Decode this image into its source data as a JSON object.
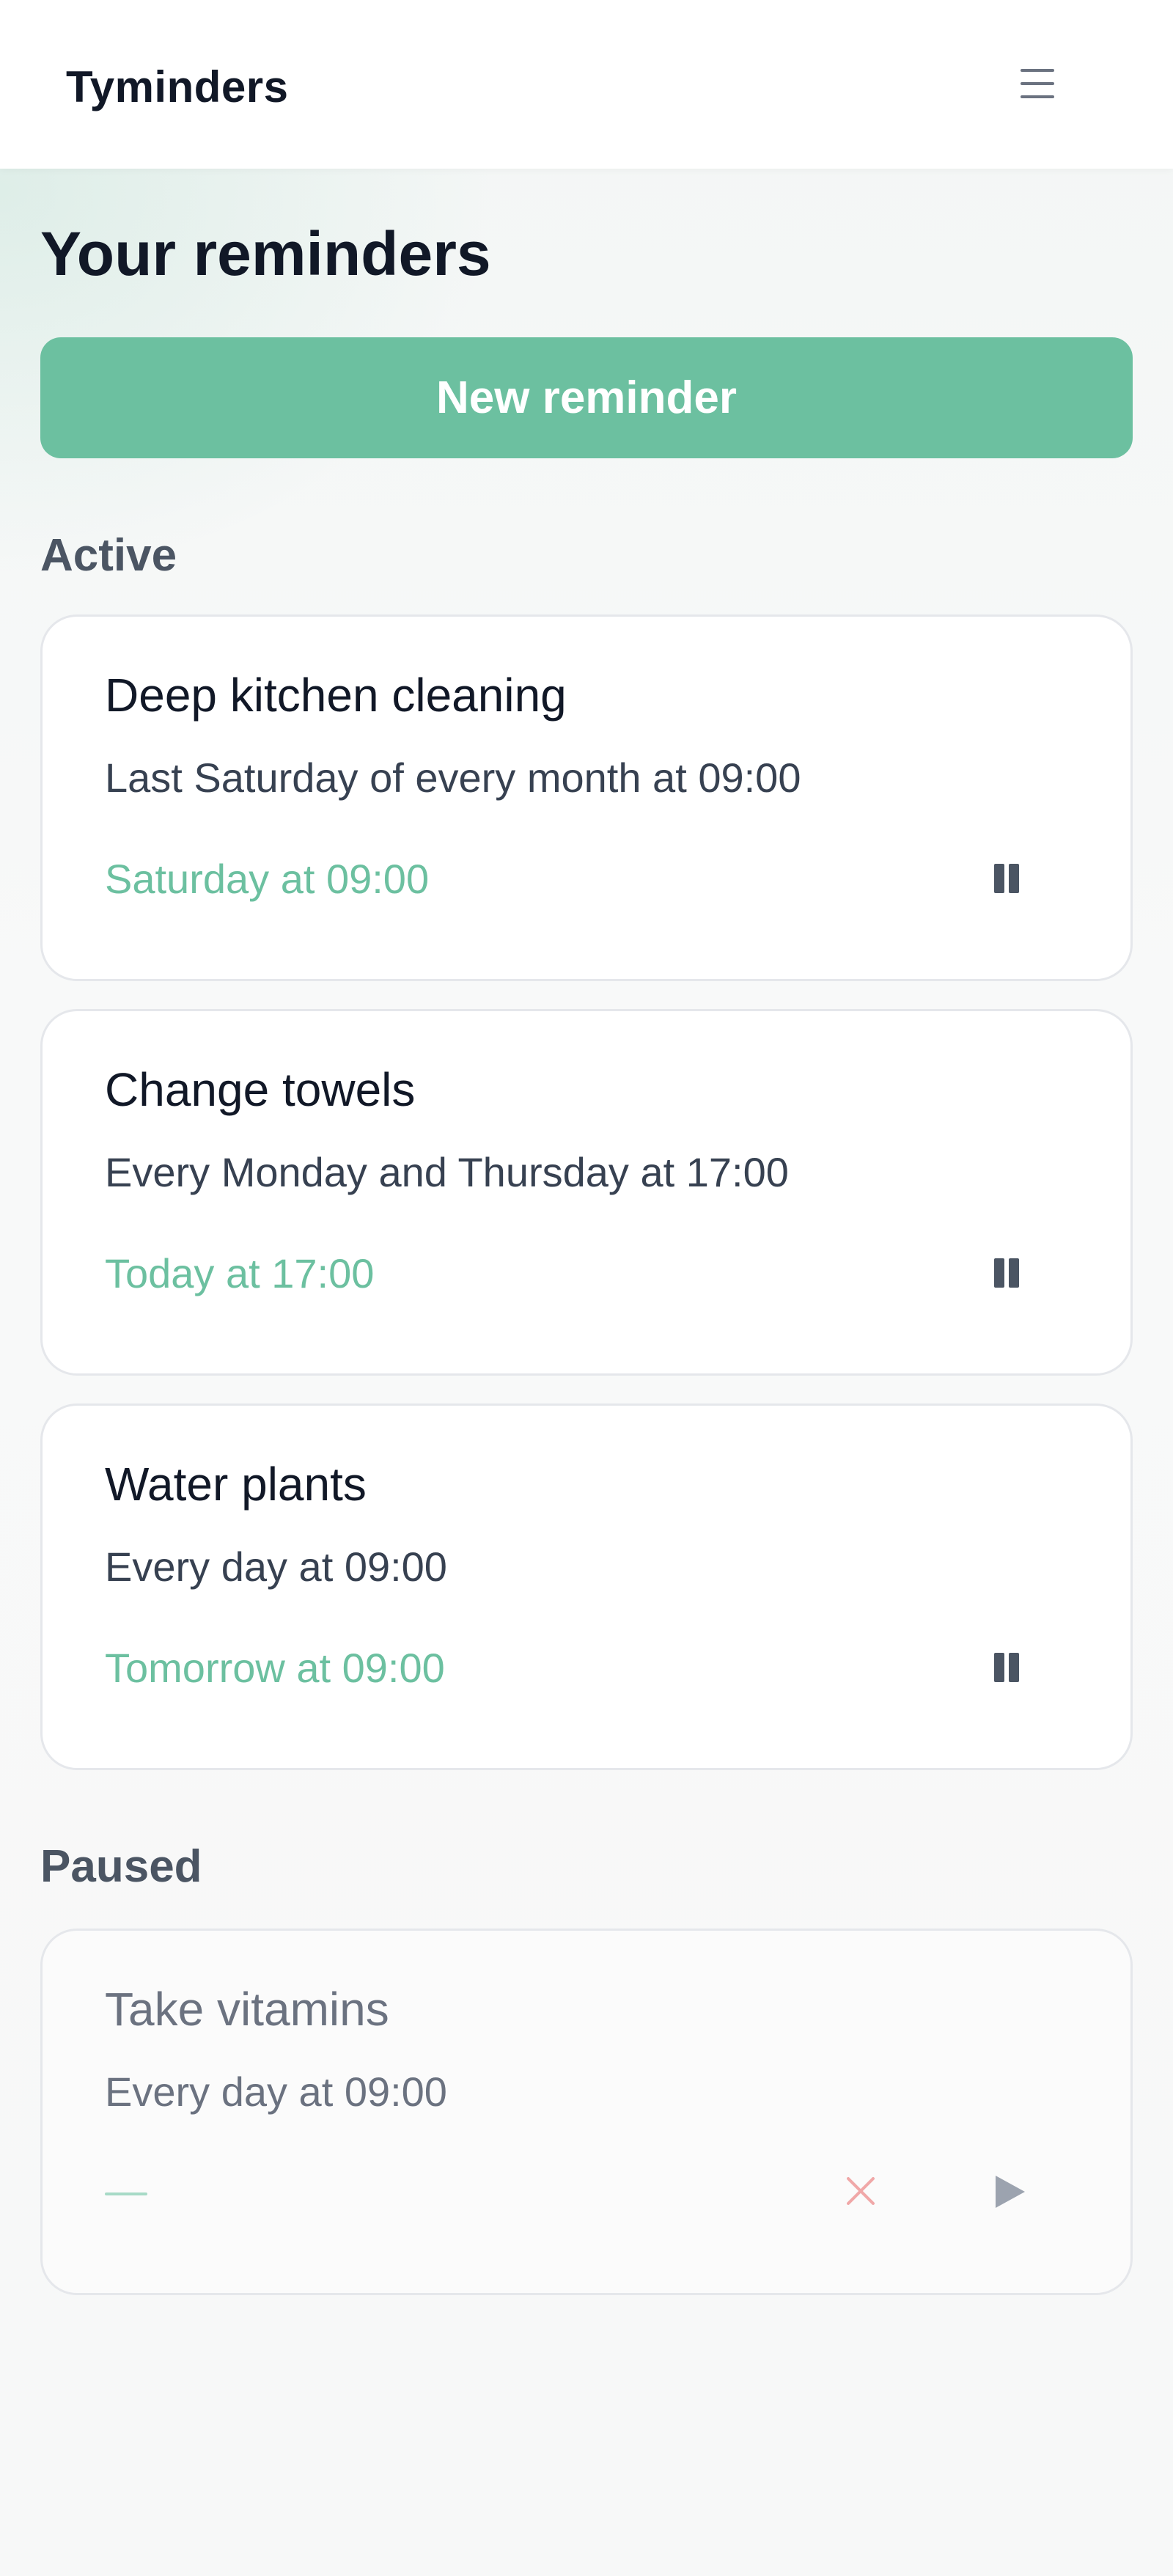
{
  "header": {
    "brand": "Tyminders",
    "menu_icon": "hamburger-menu-icon"
  },
  "main": {
    "title": "Your reminders",
    "new_button_label": "New reminder"
  },
  "sections": {
    "active_label": "Active",
    "paused_label": "Paused"
  },
  "active_reminders": [
    {
      "title": "Deep kitchen cleaning",
      "schedule": "Last Saturday of every month at 09:00",
      "next": "Saturday at 09:00",
      "action_icon": "pause-icon"
    },
    {
      "title": "Change towels",
      "schedule": "Every Monday and Thursday at 17:00",
      "next": "Today at 17:00",
      "action_icon": "pause-icon"
    },
    {
      "title": "Water plants",
      "schedule": "Every day at 09:00",
      "next": "Tomorrow at 09:00",
      "action_icon": "pause-icon"
    }
  ],
  "paused_reminders": [
    {
      "title": "Take vitamins",
      "schedule": "Every day at 09:00",
      "next": "—",
      "delete_icon": "close-icon",
      "resume_icon": "play-icon"
    }
  ],
  "colors": {
    "accent": "#6cc0a0",
    "delete": "#f0a8a8",
    "text": "#111827",
    "muted": "#6b7280"
  }
}
